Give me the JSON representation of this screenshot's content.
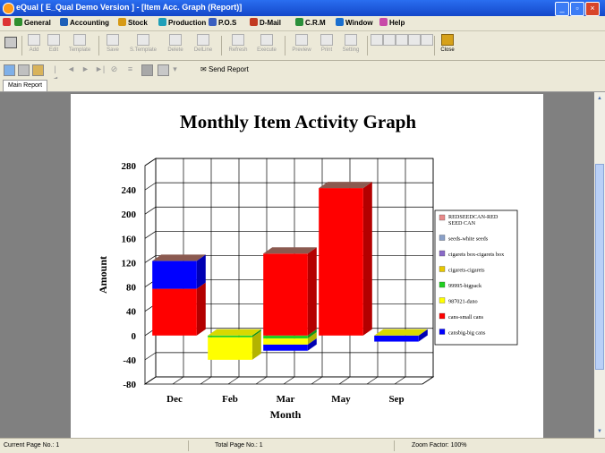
{
  "window": {
    "title": "eQual [ E_Qual Demo Version ] - [Item Acc. Graph (Report)]",
    "buttons": [
      "_",
      "▫",
      "×"
    ]
  },
  "menu": [
    {
      "label": "General",
      "icon": "general-icon",
      "color": "#2f8f2f"
    },
    {
      "label": "Accounting",
      "icon": "accounting-icon",
      "color": "#1d5fb8"
    },
    {
      "label": "Stock",
      "icon": "stock-icon",
      "color": "#d69a16"
    },
    {
      "label": "Production",
      "icon": "production-icon",
      "color": "#1f9fb8"
    },
    {
      "label": "P.O.S",
      "icon": "pos-icon",
      "color": "#3a5fbf"
    },
    {
      "label": "D-Mail",
      "icon": "dmail-icon",
      "color": "#c23a20"
    },
    {
      "label": "C.R.M",
      "icon": "crm-icon",
      "color": "#2a8f3a"
    },
    {
      "label": "Window",
      "icon": "window-icon",
      "color": "#1a6fcf"
    },
    {
      "label": "Help",
      "icon": "help-icon",
      "color": "#c84aa8"
    }
  ],
  "toolbar": [
    {
      "label": "Add",
      "enabled": false
    },
    {
      "label": "Edit",
      "enabled": false
    },
    {
      "label": "Template",
      "enabled": false
    },
    {
      "label": "Save",
      "enabled": false
    },
    {
      "label": "S.Template",
      "enabled": false
    },
    {
      "label": "Delete",
      "enabled": false
    },
    {
      "label": "DelLine",
      "enabled": false
    },
    {
      "label": "Refresh",
      "enabled": false
    },
    {
      "label": "Execute",
      "enabled": false
    },
    {
      "label": "Preview",
      "enabled": false
    },
    {
      "label": "Print",
      "enabled": false
    },
    {
      "label": "Setting",
      "enabled": false
    },
    {
      "label": "Close",
      "enabled": true
    }
  ],
  "report_toolbar": {
    "send_label": "Send Report"
  },
  "tabs": [
    {
      "label": "Main Report"
    }
  ],
  "status": {
    "current_page": "Current Page No.: 1",
    "total_page": "Total Page No.: 1",
    "zoom": "Zoom Factor: 100%"
  },
  "chart_data": {
    "type": "bar",
    "stacked": true,
    "three_d": true,
    "title": "Monthly Item Activity Graph",
    "xlabel": "Month",
    "ylabel": "Amount",
    "ylim": [
      -80,
      280
    ],
    "yticks": [
      280,
      240,
      200,
      160,
      120,
      80,
      40,
      0,
      -40,
      -80
    ],
    "grid": true,
    "legend_position": "right",
    "categories": [
      "Dec",
      "Feb",
      "Mar",
      "May",
      "Sep"
    ],
    "series": [
      {
        "name": "REDSEEDCAN-RED SEED CAN",
        "color": "#e88a8a",
        "values": [
          0,
          0,
          0,
          0,
          0
        ]
      },
      {
        "name": "seeds-white seeds",
        "color": "#8aa0c8",
        "values": [
          0,
          0,
          0,
          0,
          0
        ]
      },
      {
        "name": "cigarets box-cigarets box",
        "color": "#8a6ac8",
        "values": [
          0,
          0,
          0,
          0,
          0
        ]
      },
      {
        "name": "cigarets-cigarets",
        "color": "#e8c800",
        "values": [
          0,
          0,
          0,
          0,
          0
        ]
      },
      {
        "name": "99995-bigpack",
        "color": "#20d020",
        "values": [
          0,
          -3,
          -5,
          0,
          0
        ]
      },
      {
        "name": "987021-dano",
        "color": "#ffff00",
        "values": [
          0,
          -37,
          -10,
          0,
          0
        ]
      },
      {
        "name": "cans-small cans",
        "color": "#ff0000",
        "values": [
          77,
          0,
          135,
          243,
          0
        ]
      },
      {
        "name": "cansbig-big cans",
        "color": "#0000ff",
        "values": [
          46,
          0,
          -10,
          0,
          -10
        ]
      }
    ],
    "top_face_color": "#8b5a50"
  }
}
